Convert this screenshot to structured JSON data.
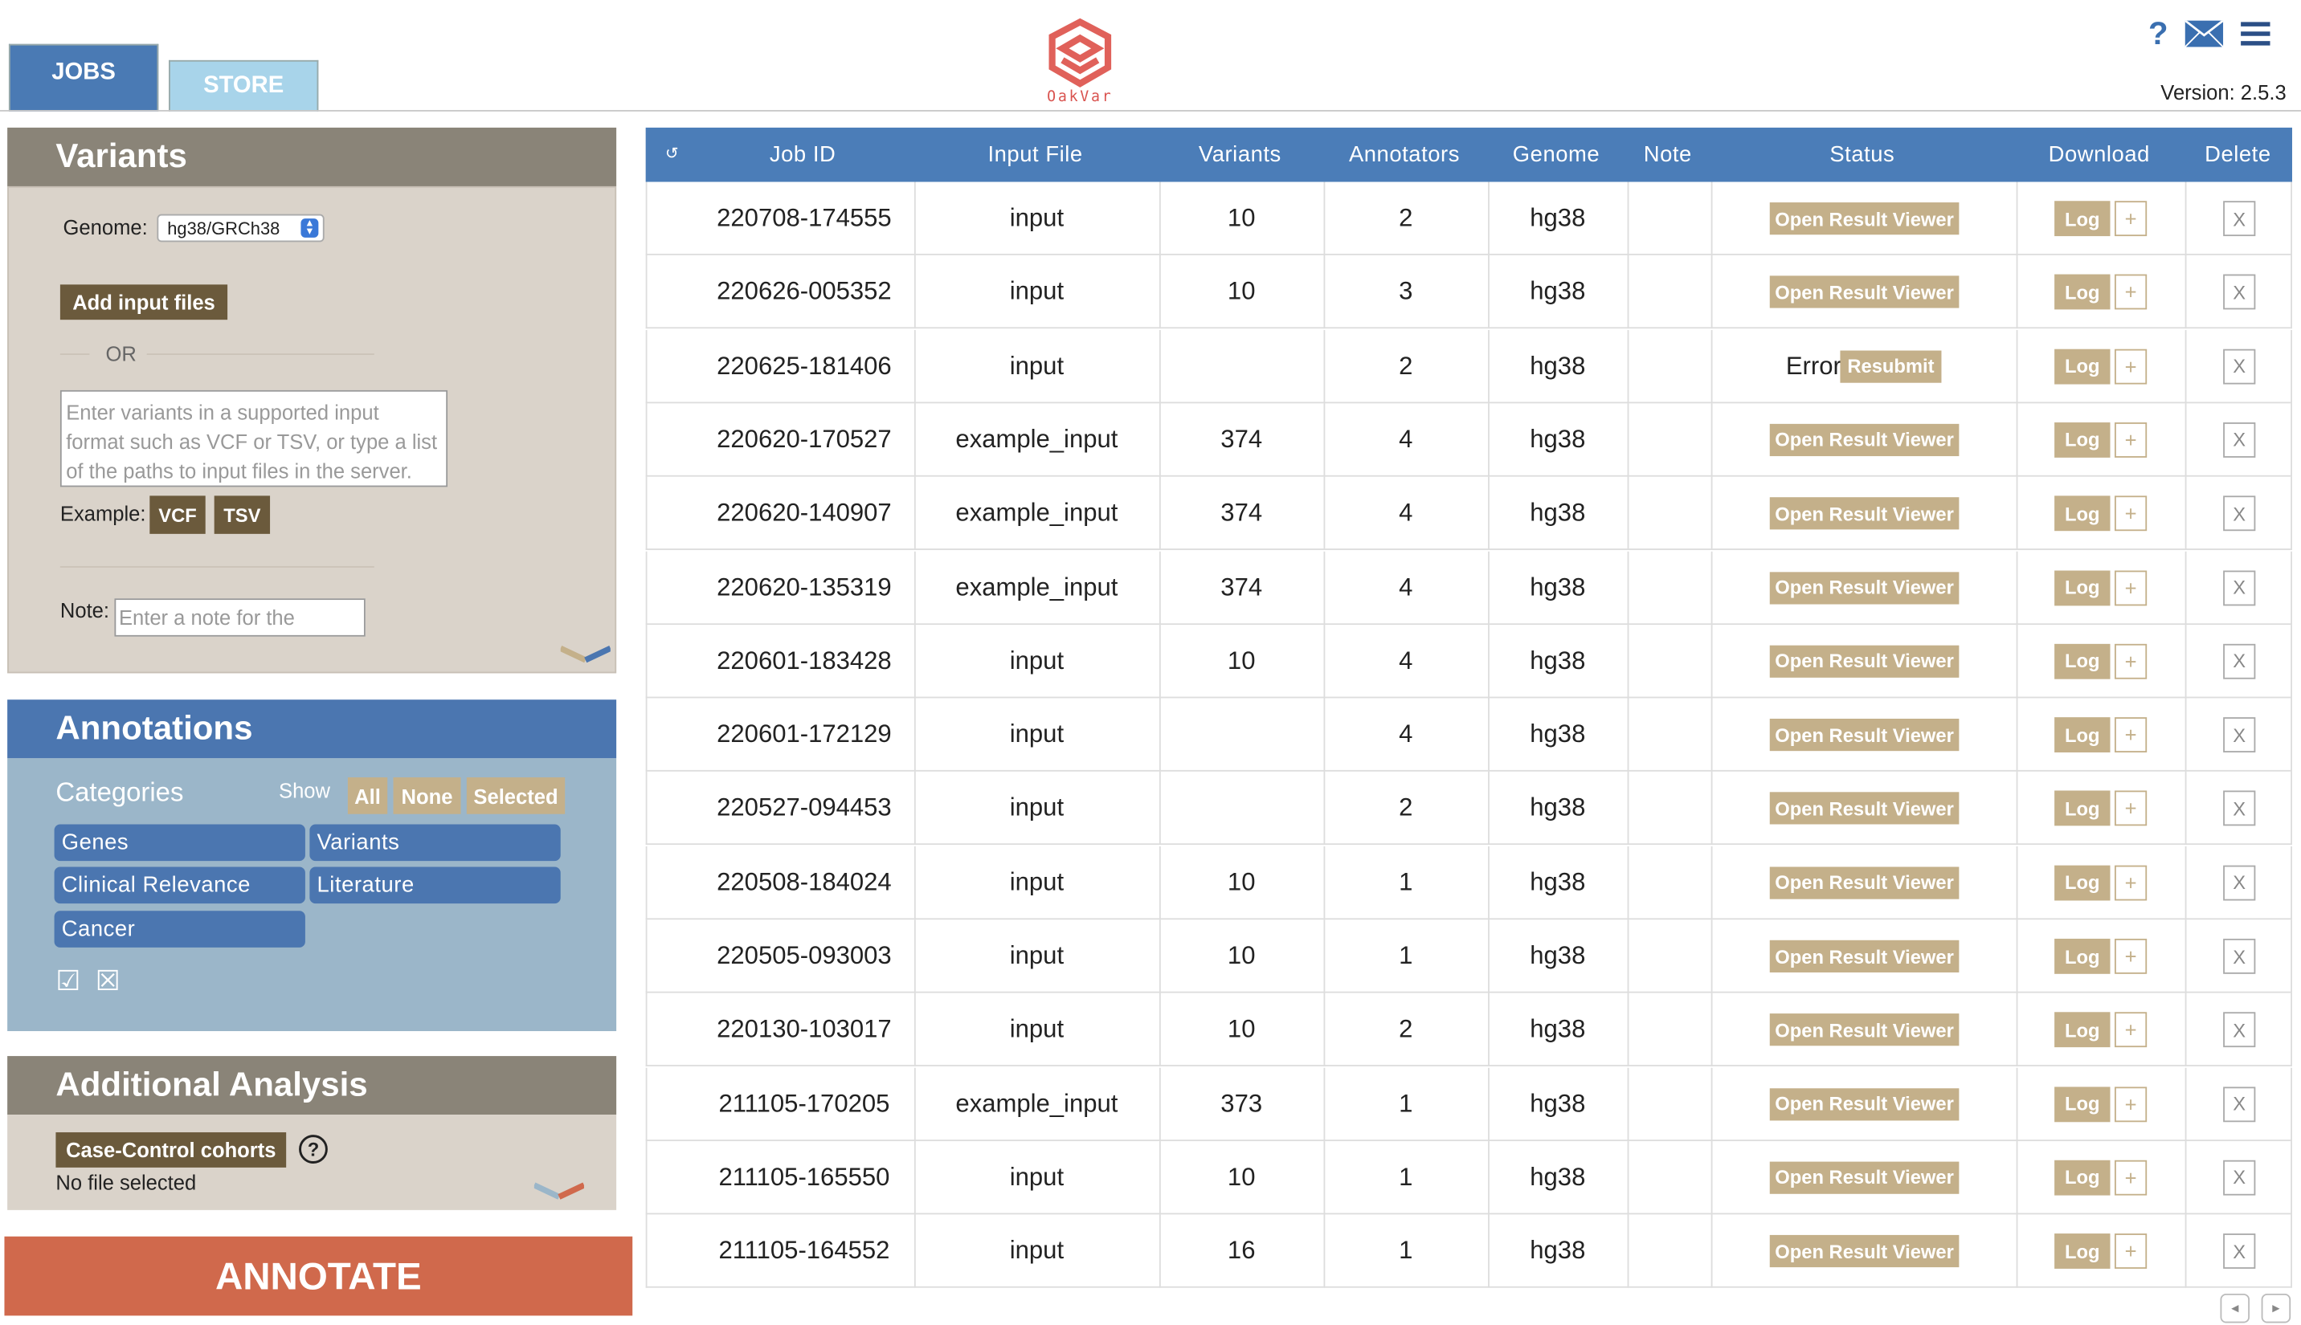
{
  "tabs": {
    "jobs": "JOBS",
    "store": "STORE"
  },
  "brand": {
    "name": "OakVar"
  },
  "header": {
    "help": "?",
    "version": "Version: 2.5.3"
  },
  "variants": {
    "title": "Variants",
    "genome_label": "Genome:",
    "genome_value": "hg38/GRCh38",
    "add_files": "Add input files",
    "or": "OR",
    "input_placeholder": "Enter variants in a supported input format such as VCF or TSV, or type a list of the paths to input files in the server.",
    "example_label": "Example:",
    "example_vcf": "VCF",
    "example_tsv": "TSV",
    "note_label": "Note:",
    "note_placeholder": "Enter a note for the"
  },
  "annotations": {
    "title": "Annotations",
    "categories_label": "Categories",
    "show_label": "Show",
    "show_all": "All",
    "show_none": "None",
    "show_selected": "Selected",
    "categories": [
      "Genes",
      "Variants",
      "Clinical Relevance",
      "Literature",
      "Cancer"
    ],
    "check_all": "☑",
    "uncheck_all": "☒"
  },
  "additional": {
    "title": "Additional Analysis",
    "cohorts_button": "Case-Control cohorts",
    "file_status": "No file selected"
  },
  "annotate_button": "ANNOTATE",
  "table": {
    "headers": {
      "refresh": "↺",
      "job_id": "Job ID",
      "input_file": "Input File",
      "variants": "Variants",
      "annotators": "Annotators",
      "genome": "Genome",
      "note": "Note",
      "status": "Status",
      "download": "Download",
      "delete": "Delete"
    },
    "open_viewer": "Open Result Viewer",
    "error": "Error",
    "resubmit": "Resubmit",
    "log": "Log",
    "plus": "+",
    "delete": "X",
    "rows": [
      {
        "job_id": "220708-174555",
        "input": "input",
        "variants": "10",
        "annotators": "2",
        "genome": "hg38",
        "note": "",
        "status": "ok"
      },
      {
        "job_id": "220626-005352",
        "input": "input",
        "variants": "10",
        "annotators": "3",
        "genome": "hg38",
        "note": "",
        "status": "ok"
      },
      {
        "job_id": "220625-181406",
        "input": "input",
        "variants": "",
        "annotators": "2",
        "genome": "hg38",
        "note": "",
        "status": "error"
      },
      {
        "job_id": "220620-170527",
        "input": "example_input",
        "variants": "374",
        "annotators": "4",
        "genome": "hg38",
        "note": "",
        "status": "ok"
      },
      {
        "job_id": "220620-140907",
        "input": "example_input",
        "variants": "374",
        "annotators": "4",
        "genome": "hg38",
        "note": "",
        "status": "ok"
      },
      {
        "job_id": "220620-135319",
        "input": "example_input",
        "variants": "374",
        "annotators": "4",
        "genome": "hg38",
        "note": "",
        "status": "ok"
      },
      {
        "job_id": "220601-183428",
        "input": "input",
        "variants": "10",
        "annotators": "4",
        "genome": "hg38",
        "note": "",
        "status": "ok"
      },
      {
        "job_id": "220601-172129",
        "input": "input",
        "variants": "",
        "annotators": "4",
        "genome": "hg38",
        "note": "",
        "status": "ok"
      },
      {
        "job_id": "220527-094453",
        "input": "input",
        "variants": "",
        "annotators": "2",
        "genome": "hg38",
        "note": "",
        "status": "ok"
      },
      {
        "job_id": "220508-184024",
        "input": "input",
        "variants": "10",
        "annotators": "1",
        "genome": "hg38",
        "note": "",
        "status": "ok"
      },
      {
        "job_id": "220505-093003",
        "input": "input",
        "variants": "10",
        "annotators": "1",
        "genome": "hg38",
        "note": "",
        "status": "ok"
      },
      {
        "job_id": "220130-103017",
        "input": "input",
        "variants": "10",
        "annotators": "2",
        "genome": "hg38",
        "note": "",
        "status": "ok"
      },
      {
        "job_id": "211105-170205",
        "input": "example_input",
        "variants": "373",
        "annotators": "1",
        "genome": "hg38",
        "note": "",
        "status": "ok"
      },
      {
        "job_id": "211105-165550",
        "input": "input",
        "variants": "10",
        "annotators": "1",
        "genome": "hg38",
        "note": "",
        "status": "ok"
      },
      {
        "job_id": "211105-164552",
        "input": "input",
        "variants": "16",
        "annotators": "1",
        "genome": "hg38",
        "note": "",
        "status": "ok"
      }
    ]
  },
  "colors": {
    "accent_blue": "#4b7db8",
    "button_tan": "#c4b08a",
    "annotate_orange": "#d0694c",
    "brand_red": "#d9534f"
  }
}
